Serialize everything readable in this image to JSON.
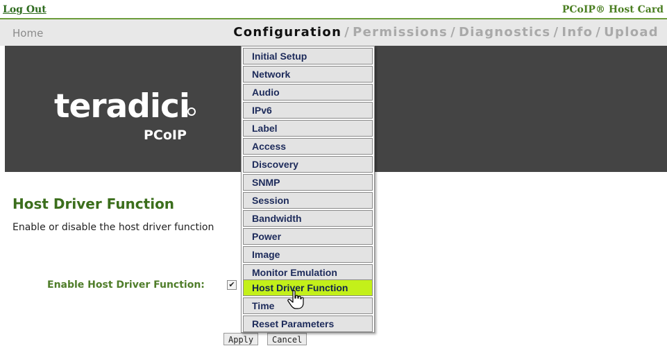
{
  "header": {
    "logout_label": "Log Out",
    "product_label": "PCoIP® Host Card"
  },
  "nav": {
    "home": "Home",
    "items": [
      "Configuration",
      "Permissions",
      "Diagnostics",
      "Info",
      "Upload"
    ],
    "separator": "/",
    "active": "Configuration"
  },
  "brand": {
    "logo_text": "teradici",
    "logo_sub": "PCoIP"
  },
  "page": {
    "title": "Host Driver Function",
    "description": "Enable or disable the host driver function",
    "field_label": "Enable Host Driver Function:",
    "field_checked": true,
    "apply_label": "Apply",
    "cancel_label": "Cancel"
  },
  "dropdown": {
    "items": [
      "Initial Setup",
      "Network",
      "Audio",
      "IPv6",
      "Label",
      "Access",
      "Discovery",
      "SNMP",
      "Session",
      "Bandwidth",
      "Power",
      "Image",
      "Monitor Emulation",
      "Host Driver Function",
      "Time",
      "Reset Parameters"
    ],
    "highlighted": "Host Driver Function"
  },
  "colors": {
    "accent_green": "#3b6e1c",
    "highlight": "#c3f01a",
    "banner": "#444444"
  }
}
